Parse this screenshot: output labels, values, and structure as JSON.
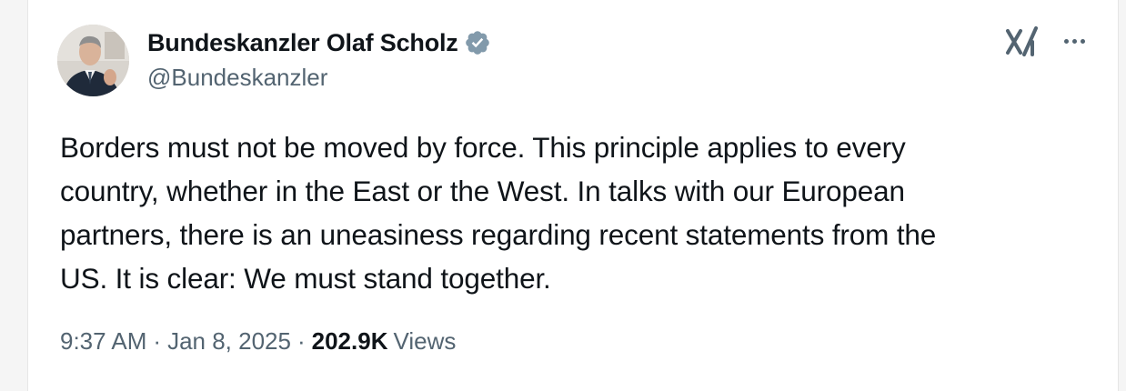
{
  "tweet": {
    "author": {
      "display_name": "Bundeskanzler Olaf Scholz",
      "handle": "@Bundeskanzler",
      "verified_badge": "verified-badge-icon",
      "verified_color": "#829aab",
      "avatar": "avatar-photo"
    },
    "actions": {
      "grok_icon": "grok-icon",
      "more_icon": "more-options-icon"
    },
    "text": "Borders must not be moved by force. This principle applies to every\ncountry, whether in the East or the West. In talks with our European\npartners, there is an uneasiness regarding recent statements from the\nUS. It is clear: We must stand together.",
    "meta": {
      "time": "9:37 AM",
      "separator": "·",
      "date": "Jan 8, 2025",
      "views_count": "202.9K",
      "views_label": "Views"
    }
  },
  "colors": {
    "text_primary": "#0f1419",
    "text_secondary": "#536471",
    "background": "#ffffff"
  }
}
